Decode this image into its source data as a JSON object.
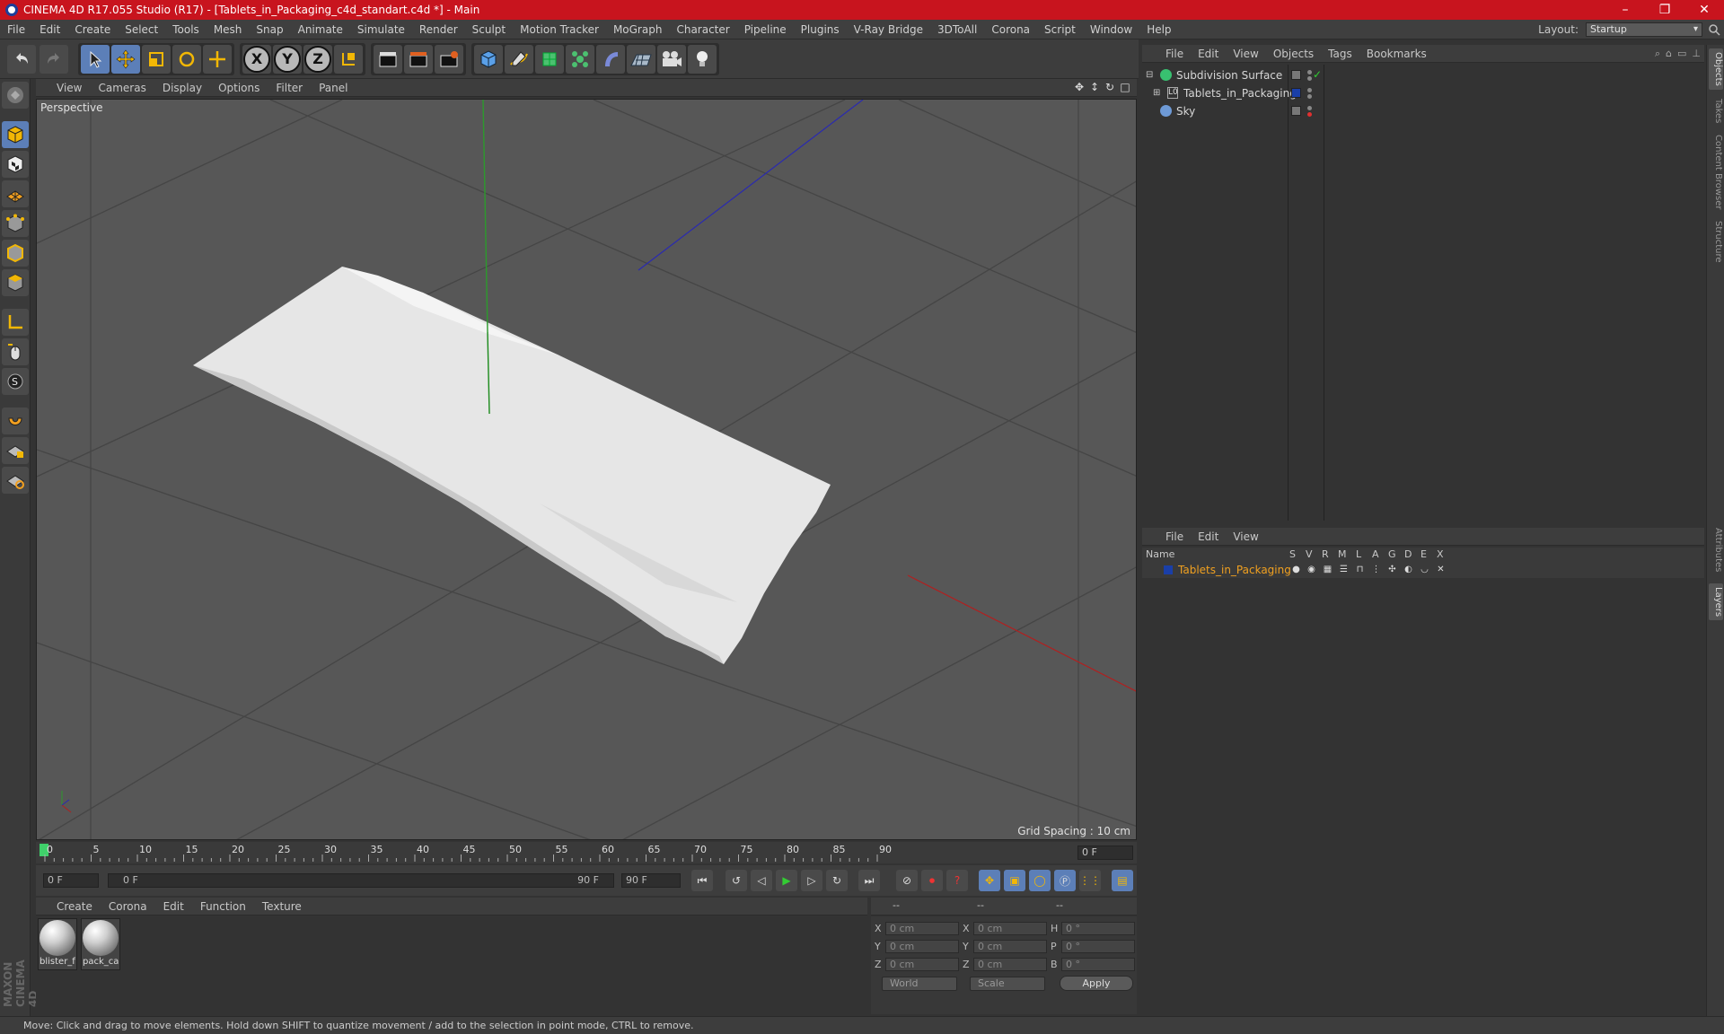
{
  "window": {
    "title": "CINEMA 4D R17.055 Studio (R17) - [Tablets_in_Packaging_c4d_standart.c4d *] - Main",
    "controls": [
      "–",
      "❐",
      "✕"
    ]
  },
  "menu": {
    "items": [
      "File",
      "Edit",
      "Create",
      "Select",
      "Tools",
      "Mesh",
      "Snap",
      "Animate",
      "Simulate",
      "Render",
      "Sculpt",
      "Motion Tracker",
      "MoGraph",
      "Character",
      "Pipeline",
      "Plugins",
      "V-Ray Bridge",
      "3DToAll",
      "Corona",
      "Script",
      "Window",
      "Help"
    ],
    "layout_label": "Layout:",
    "layout_value": "Startup"
  },
  "toolbar": {
    "axis_x": "X",
    "axis_y": "Y",
    "axis_z": "Z"
  },
  "viewport": {
    "menu": [
      "View",
      "Cameras",
      "Display",
      "Options",
      "Filter",
      "Panel"
    ],
    "camera_label": "Perspective",
    "grid_spacing": "Grid Spacing : 10 cm"
  },
  "timeline": {
    "ticks": [
      "0",
      "5",
      "10",
      "15",
      "20",
      "25",
      "30",
      "35",
      "40",
      "45",
      "50",
      "55",
      "60",
      "65",
      "70",
      "75",
      "80",
      "85",
      "90"
    ],
    "current_frame": "0 F"
  },
  "transport": {
    "start_field": "0 F",
    "range_start": "0 F",
    "range_end": "90 F",
    "end_field": "90 F"
  },
  "materials": {
    "menu": [
      "Create",
      "Corona",
      "Edit",
      "Function",
      "Texture"
    ],
    "items": [
      {
        "name": "blister_f"
      },
      {
        "name": "pack_ca"
      }
    ]
  },
  "coordinates": {
    "header": [
      "--",
      "--",
      "--"
    ],
    "rows": [
      {
        "l1": "X",
        "v1": "0 cm",
        "l2": "X",
        "v2": "0 cm",
        "l3": "H",
        "v3": "0 °"
      },
      {
        "l1": "Y",
        "v1": "0 cm",
        "l2": "Y",
        "v2": "0 cm",
        "l3": "P",
        "v3": "0 °"
      },
      {
        "l1": "Z",
        "v1": "0 cm",
        "l2": "Z",
        "v2": "0 cm",
        "l3": "B",
        "v3": "0 °"
      }
    ],
    "space": "World",
    "mode": "Scale",
    "apply": "Apply"
  },
  "objects": {
    "menu": [
      "File",
      "Edit",
      "View",
      "Objects",
      "Tags",
      "Bookmarks"
    ],
    "items": [
      {
        "name": "Subdivision Surface",
        "icon_color": "#38c070"
      },
      {
        "name": "Tablets_in_Packaging",
        "icon_color": "#8a8a8a"
      },
      {
        "name": "Sky",
        "icon_color": "#6e9ad6"
      }
    ]
  },
  "layers": {
    "menu": [
      "File",
      "Edit",
      "View"
    ],
    "columns": [
      "Name",
      "S",
      "V",
      "R",
      "M",
      "L",
      "A",
      "G",
      "D",
      "E",
      "X"
    ],
    "row_name": "Tablets_in_Packaging",
    "row_color": "#1a3fa8"
  },
  "right_tabs": [
    "Objects",
    "Takes",
    "Content Browser",
    "Structure",
    "Attributes",
    "Layers"
  ],
  "branding": "MAXON CINEMA 4D",
  "status": "Move: Click and drag to move elements. Hold down SHIFT to quantize movement / add to the selection in point mode, CTRL to remove."
}
